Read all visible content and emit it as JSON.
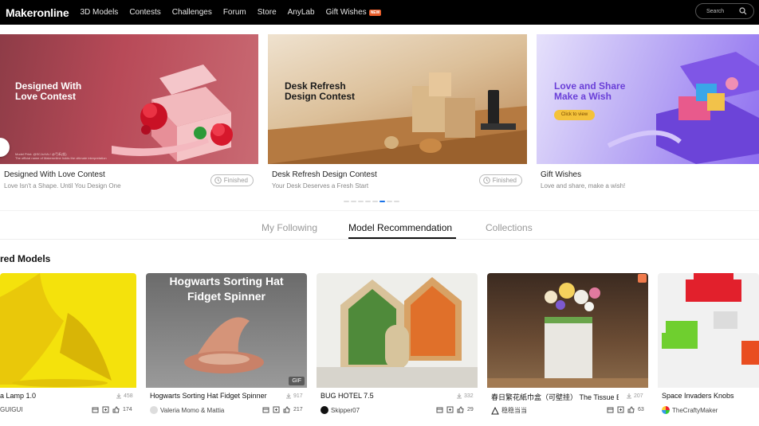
{
  "nav": {
    "logo": "Makeronline",
    "links": [
      "3D Models",
      "Contests",
      "Challenges",
      "Forum",
      "Store",
      "AnyLab",
      "Gift Wishes"
    ],
    "new_badge": "NEW",
    "search_placeholder": "Search"
  },
  "banners": [
    {
      "heading": "Designed With\nLove Contest",
      "title": "Designed With Love Contest",
      "subtitle": "Love Isn't a Shape. Until You Design One",
      "status": "Finished",
      "fine_print": "Model Print: @SCJuXAi / @弓禾(仮)\nThe official name of Makeronline holds the ultimate interpretation"
    },
    {
      "heading": "Desk Refresh\nDesign Contest",
      "title": "Desk Refresh Design Contest",
      "subtitle": "Your Desk Deserves a Fresh Start",
      "status": "Finished"
    },
    {
      "heading": "Love and Share\nMake a Wish",
      "title": "Gift Wishes",
      "subtitle": "Love and share, make a wish!",
      "cta": "Click to view"
    }
  ],
  "carousel": {
    "count": 8,
    "active_index": 5
  },
  "tabs": [
    {
      "label": "My Following",
      "active": false
    },
    {
      "label": "Model Recommendation",
      "active": true
    },
    {
      "label": "Collections",
      "active": false
    }
  ],
  "section_title": "red Models",
  "models": [
    {
      "title": "a Lamp 1.0",
      "downloads": "458",
      "author": "GUIGUI",
      "likes": "174",
      "image_text": ""
    },
    {
      "title": "Hogwarts Sorting Hat Fidget Spinner",
      "downloads": "917",
      "author": "Valeria Momo & Mattia",
      "likes": "217",
      "image_text": "Hogwarts Sorting Hat\nFidget Spinner",
      "badge": "GIF"
    },
    {
      "title": "BUG HOTEL 7.5",
      "downloads": "332",
      "author": "Skipper07",
      "likes": "29",
      "image_text": ""
    },
    {
      "title": "春日繁花紙巾盒（可壁挂） The Tissue B...",
      "downloads": "207",
      "author": "稳稳当当",
      "likes": "63",
      "image_text": ""
    },
    {
      "title": "Space Invaders Knobs",
      "downloads": "",
      "author": "TheCraftyMaker",
      "likes": "",
      "image_text": ""
    }
  ],
  "colors": {
    "nav_bg": "#000000",
    "accent_blue": "#1a73e8",
    "banner1_bg": "#b84a58",
    "banner2_bg": "#c9955d",
    "banner3_bg": "#a88ef2",
    "model1_bg": "#f4e20c"
  }
}
